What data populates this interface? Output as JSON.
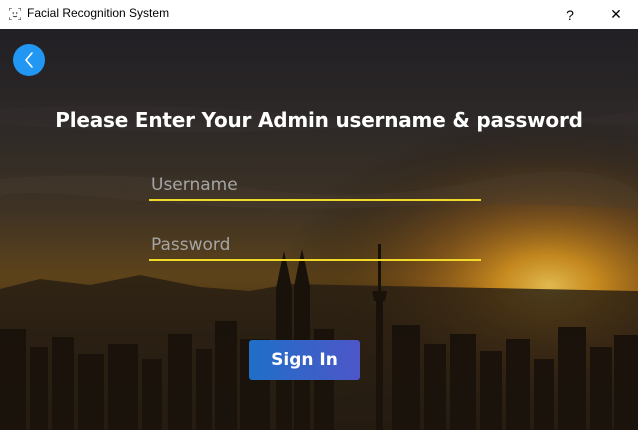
{
  "window": {
    "title": "Facial Recognition System",
    "help_label": "?",
    "close_label": "✕"
  },
  "back_button": {
    "icon": "chevron-left-icon"
  },
  "login": {
    "heading": "Please Enter Your Admin username & password",
    "username_placeholder": "Username",
    "password_placeholder": "Password",
    "sign_in_label": "Sign In"
  },
  "colors": {
    "accent_back": "#2196f3",
    "field_underline": "#f2d829",
    "button_start": "#1f6fc7",
    "button_end": "#4d56c8"
  }
}
